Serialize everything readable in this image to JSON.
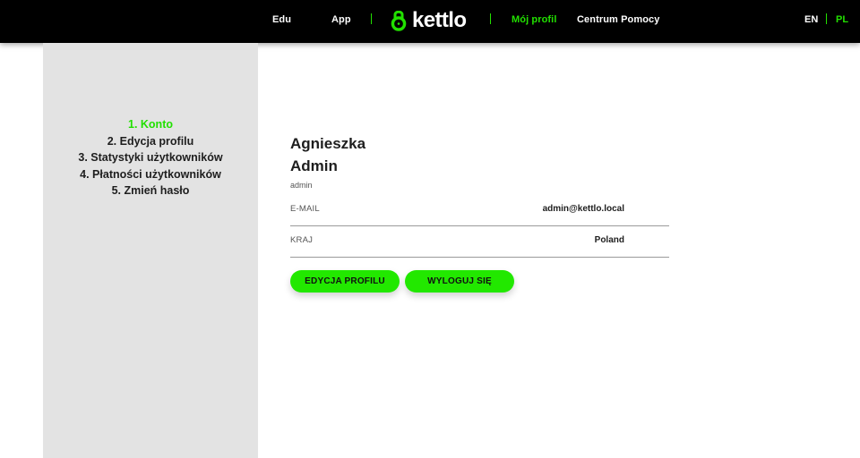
{
  "nav": {
    "edu_label": "Edu",
    "app_label": "App",
    "brand_name": "kettlo",
    "profile_label": "Mój profil",
    "help_label": "Centrum Pomocy",
    "lang_en": "EN",
    "lang_pl": "PL",
    "active_item": "Mój profil",
    "active_language": "PL"
  },
  "sidebar": {
    "items": [
      {
        "label": "1. Konto",
        "active": true
      },
      {
        "label": "2. Edycja profilu",
        "active": false
      },
      {
        "label": "3. Statystyki użytkowników",
        "active": false
      },
      {
        "label": "4. Płatności użytkowników",
        "active": false
      },
      {
        "label": "5. Zmień hasło",
        "active": false
      }
    ]
  },
  "profile": {
    "first_name": "Agnieszka",
    "last_name": "Admin",
    "username": "admin",
    "fields": [
      {
        "label": "E-MAIL",
        "value": "admin@kettlo.local"
      },
      {
        "label": "KRAJ",
        "value": "Poland"
      }
    ]
  },
  "actions": {
    "edit_profile": "EDYCJA PROFILU",
    "logout": "WYLOGUJ SIĘ"
  },
  "colors": {
    "accent": "#22e000",
    "topbar": "#000000",
    "sidebar": "#e3e3e3",
    "button": "#22e800"
  },
  "icons": {
    "brand": "kettlebell-logo-icon"
  }
}
